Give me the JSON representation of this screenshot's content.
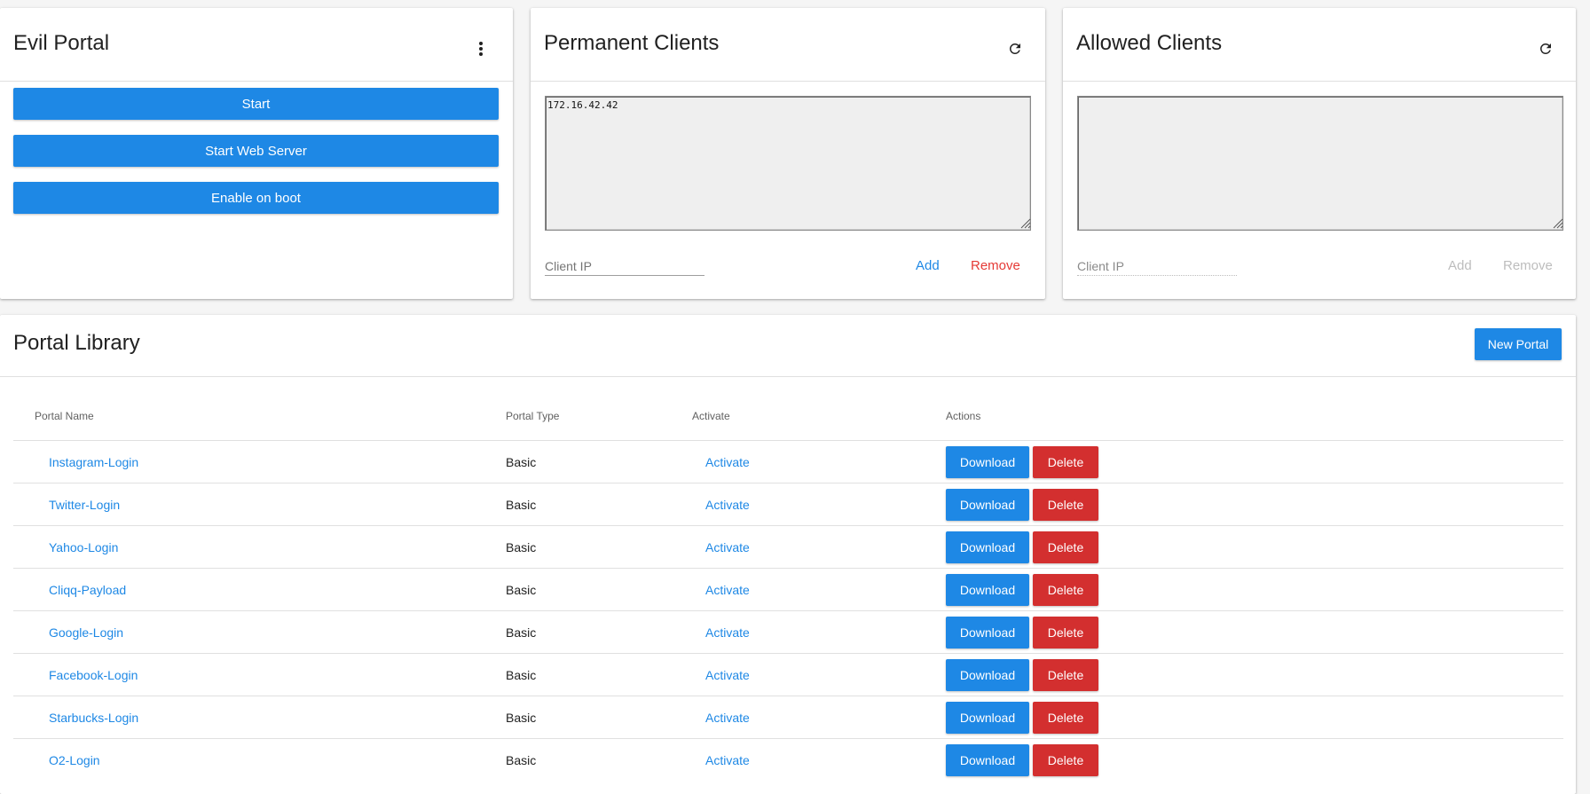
{
  "evil_portal": {
    "title": "Evil Portal",
    "menu_icon": "more-vert-icon",
    "buttons": [
      "Start",
      "Start Web Server",
      "Enable on boot"
    ]
  },
  "permanent_clients": {
    "title": "Permanent Clients",
    "refresh_icon": "refresh-icon",
    "list": "172.16.42.42",
    "ip_placeholder": "Client IP",
    "add_label": "Add",
    "remove_label": "Remove"
  },
  "allowed_clients": {
    "title": "Allowed Clients",
    "refresh_icon": "refresh-icon",
    "list": "",
    "ip_placeholder": "Client IP",
    "add_label": "Add",
    "remove_label": "Remove"
  },
  "portal_library": {
    "title": "Portal Library",
    "new_portal_label": "New Portal",
    "columns": [
      "Portal Name",
      "Portal Type",
      "Activate",
      "Actions"
    ],
    "rows": [
      {
        "name": "Instagram-Login",
        "type": "Basic",
        "activate": "Activate",
        "download": "Download",
        "delete": "Delete"
      },
      {
        "name": "Twitter-Login",
        "type": "Basic",
        "activate": "Activate",
        "download": "Download",
        "delete": "Delete"
      },
      {
        "name": "Yahoo-Login",
        "type": "Basic",
        "activate": "Activate",
        "download": "Download",
        "delete": "Delete"
      },
      {
        "name": "Cliqq-Payload",
        "type": "Basic",
        "activate": "Activate",
        "download": "Download",
        "delete": "Delete"
      },
      {
        "name": "Google-Login",
        "type": "Basic",
        "activate": "Activate",
        "download": "Download",
        "delete": "Delete"
      },
      {
        "name": "Facebook-Login",
        "type": "Basic",
        "activate": "Activate",
        "download": "Download",
        "delete": "Delete"
      },
      {
        "name": "Starbucks-Login",
        "type": "Basic",
        "activate": "Activate",
        "download": "Download",
        "delete": "Delete"
      },
      {
        "name": "O2-Login",
        "type": "Basic",
        "activate": "Activate",
        "download": "Download",
        "delete": "Delete"
      }
    ]
  },
  "colors": {
    "primary": "#1e88e5",
    "danger": "#d32f2f",
    "remove_text": "#e53935",
    "background": "#f5f5f5"
  }
}
